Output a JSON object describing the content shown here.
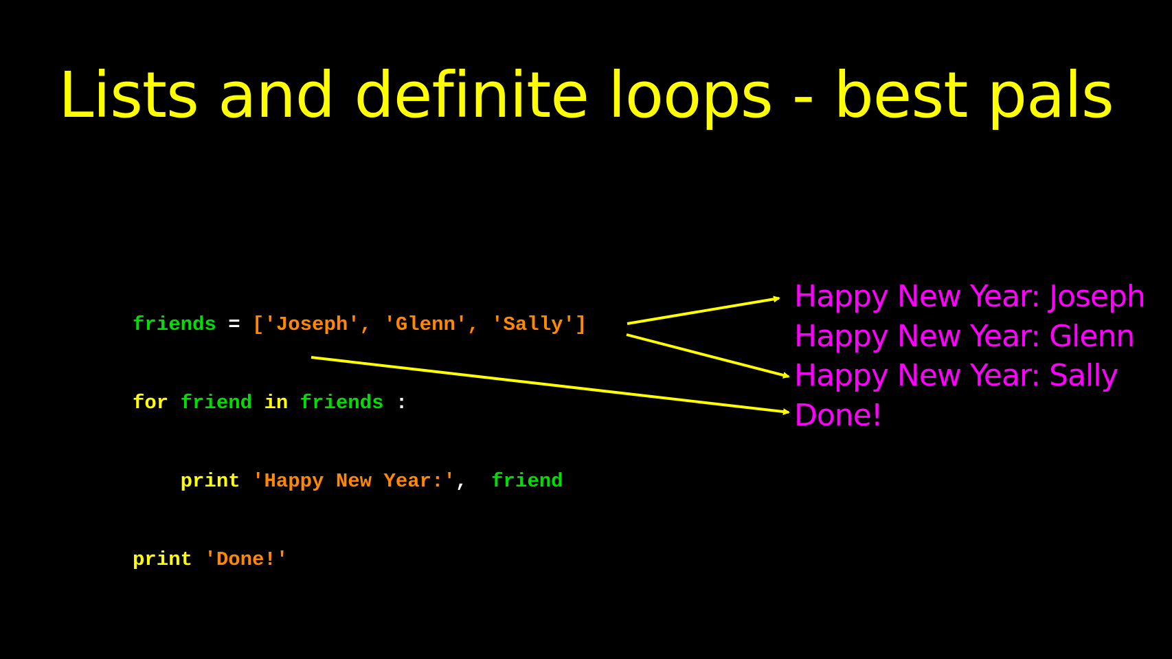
{
  "title": "Lists and definite loops - best pals",
  "code": {
    "line1": {
      "var": "friends",
      "assign": " = ",
      "list": "['Joseph', 'Glenn', 'Sally']"
    },
    "line2": {
      "kw_for": "for",
      "loop_var": "friend",
      "kw_in": "in",
      "iterable": "friends",
      "colon": " :"
    },
    "line3": {
      "indent": "    ",
      "kw_print": "print",
      "string": "'Happy New Year:'",
      "comma": ",",
      "arg": "friend"
    },
    "line4": {
      "kw_print": "print",
      "string": "'Done!'"
    }
  },
  "output": [
    "Happy New Year: Joseph",
    "Happy New Year: Glenn",
    "Happy New Year: Sally",
    "Done!"
  ],
  "colors": {
    "background": "#000000",
    "title": "#FFFF00",
    "code_variable": "#00DD00",
    "code_string": "#FF8800",
    "code_keyword": "#FFFF00",
    "code_punctuation": "#FFFFFF",
    "output_text": "#FF00FF",
    "arrow": "#FFFF00"
  }
}
